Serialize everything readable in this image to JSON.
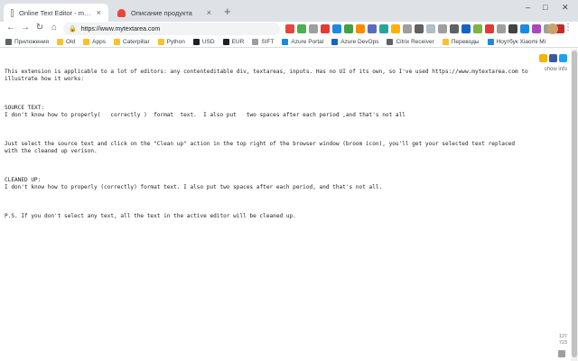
{
  "tabs": [
    {
      "title": "Online Text Editor - myTextarea",
      "close": "×"
    },
    {
      "title": "Описание продукта",
      "close": "×"
    }
  ],
  "new_tab": "+",
  "window_controls": {
    "minimize": "–",
    "maximize": "□",
    "close": "✕"
  },
  "nav": {
    "back": "←",
    "forward": "→",
    "reload": "↻",
    "home": "⌂"
  },
  "address": {
    "lock": "🔒",
    "url": "https://www.mytextarea.com"
  },
  "extension_colors": [
    "#e8453c",
    "#4caf50",
    "#9e9e9e",
    "#e53935",
    "#1e88e5",
    "#43a047",
    "#fb8c00",
    "#5c6bc0",
    "#26a69a",
    "#ffb300",
    "#9e9e9e",
    "#616161",
    "#b0bec5",
    "#9e9e9e",
    "#616161",
    "#1565c0",
    "#7cb342",
    "#e53935",
    "#9e9e9e",
    "#424242",
    "#1e88e5",
    "#ab47bc",
    "#9e9e9e",
    "#c62828"
  ],
  "menu_icon": "⋮",
  "bookmarks": [
    {
      "label": "Приложения",
      "color": "#5f6368"
    },
    {
      "label": "Old",
      "color": "#fbc02d"
    },
    {
      "label": "Apps",
      "color": "#fbc02d"
    },
    {
      "label": "Caterpillar",
      "color": "#fbc02d"
    },
    {
      "label": "Python",
      "color": "#fbc02d"
    },
    {
      "label": "USD",
      "color": "#202124"
    },
    {
      "label": "EUR",
      "color": "#202124"
    },
    {
      "label": "SIFT",
      "color": "#9e9e9e"
    },
    {
      "label": "Azure Portal",
      "color": "#1e88e5"
    },
    {
      "label": "Azure DevOps",
      "color": "#1565c0"
    },
    {
      "label": "Citrix Receiver",
      "color": "#5f6368"
    },
    {
      "label": "Переводы",
      "color": "#fbc02d"
    },
    {
      "label": "Ноутбук Xiaomi Mi",
      "color": "#1e88e5"
    }
  ],
  "editor": {
    "intro": "This extension is applicable to a lot of editors: any contenteditable div, textareas, inputs. Has no UI of its own, so I've used https://www.mytextarea.com to illustrate how it works:",
    "instruction": "Just select the source text and click on the \"Clean up\" action in the top right of the browser window (broom icon), you'll get your selected text replaced with the cleaned up verison.",
    "source_heading": "SOURCE TEXT:",
    "source_text": "I don't know how to properly(   correctly )  format  text.  I also put   two spaces after each period ,and that's not all",
    "cleaned_heading": "CLEANED UP:",
    "cleaned_text": "I don't know how to properly (correctly) format text. I also put two spaces after each period, and that's not all.",
    "ps": "P.S. If you don't select any text, all the text in the active editor will be cleaned up."
  },
  "side_icon_colors": [
    "#f4b400",
    "#3b5998",
    "#1da1f2"
  ],
  "show_info": "show info",
  "counts": {
    "chars": "127",
    "words": "723"
  }
}
